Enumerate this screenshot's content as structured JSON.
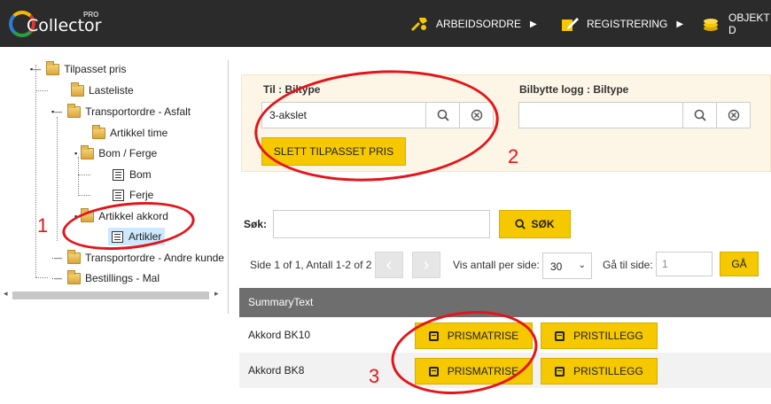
{
  "app": {
    "logo_text": "Collector",
    "logo_badge": "PRO"
  },
  "nav": [
    {
      "label": "ARBEIDSORDRE",
      "icon": "tools-icon"
    },
    {
      "label": "REGISTRERING",
      "icon": "edit-icon"
    },
    {
      "label": "OBJEKT D",
      "icon": "coins-icon"
    }
  ],
  "tree": {
    "items": [
      {
        "label": "Tilpasset pris"
      },
      {
        "label": "Lasteliste"
      },
      {
        "label": "Transportordre - Asfalt"
      },
      {
        "label": "Artikkel time"
      },
      {
        "label": "Bom / Ferge"
      },
      {
        "label": "Bom"
      },
      {
        "label": "Ferje"
      },
      {
        "label": "Artikkel akkord"
      },
      {
        "label": "Artikler"
      },
      {
        "label": "Transportordre - Andre kunde"
      },
      {
        "label": "Bestillings - Mal"
      }
    ]
  },
  "filter": {
    "field1_label": "Til : Biltype",
    "field1_value": "3-akslet",
    "field2_label": "Bilbytte logg : Biltype",
    "field2_value": "",
    "delete_button": "SLETT TILPASSET PRIS"
  },
  "search": {
    "label": "Søk:",
    "button": "SØK"
  },
  "pager": {
    "info": "Side 1 of 1, Antall 1-2 of 2",
    "per_page_label": "Vis antall per side:",
    "per_page_value": "30",
    "goto_label": "Gå til side:",
    "goto_value": "1",
    "goto_button": "GÅ"
  },
  "table": {
    "header": "SummaryText",
    "rows": [
      {
        "text": "Akkord BK10",
        "btn1": "PRISMATRISE",
        "btn2": "PRISTILLEGG"
      },
      {
        "text": "Akkord BK8",
        "btn1": "PRISMATRISE",
        "btn2": "PRISTILLEGG"
      }
    ]
  },
  "annotations": {
    "n1": "1",
    "n2": "2",
    "n3": "3",
    "color": "#e4141a"
  }
}
